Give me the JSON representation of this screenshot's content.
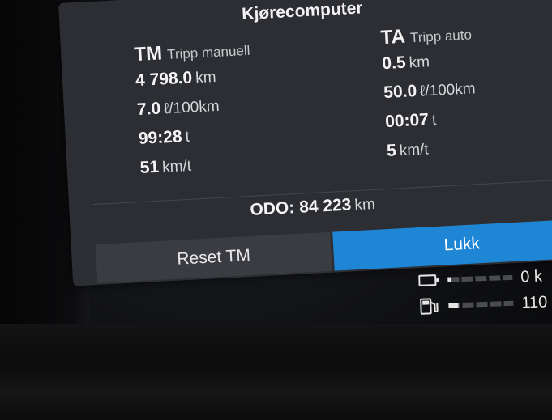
{
  "screen": {
    "title": "Kjørecomputer",
    "trip_manual": {
      "code": "TM",
      "name": "Tripp manuell",
      "rows": [
        {
          "value": "4 798.0",
          "unit": "km"
        },
        {
          "value": "7.0",
          "unit": "ℓ/100km"
        },
        {
          "value": "99:28",
          "unit": "t"
        },
        {
          "value": "51",
          "unit": "km/t"
        }
      ]
    },
    "trip_auto": {
      "code": "TA",
      "name": "Tripp auto",
      "rows": [
        {
          "value": "0.5",
          "unit": "km"
        },
        {
          "value": "50.0",
          "unit": "ℓ/100km"
        },
        {
          "value": "00:07",
          "unit": "t"
        },
        {
          "value": "5",
          "unit": "km/t"
        }
      ]
    },
    "odometer": {
      "label": "ODO:",
      "value": "84 223",
      "unit": "km"
    },
    "buttons": {
      "reset": "Reset TM",
      "close": "Lukk"
    }
  },
  "gauges": {
    "battery": {
      "icon": "battery-icon",
      "text": "0 k",
      "level": 0.05
    },
    "fuel": {
      "icon": "fuel-pump-icon",
      "text": "110",
      "level": 0.15
    }
  },
  "colors": {
    "accent": "#1f86d6",
    "panel": "#2c2e33",
    "secondary_button": "#3a3c42"
  }
}
